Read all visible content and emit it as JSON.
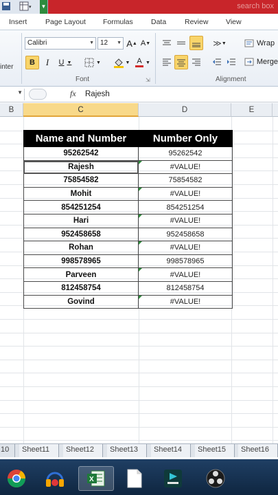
{
  "title_bar": {
    "search_placeholder": "search box"
  },
  "ribbon_tabs": [
    "Insert",
    "Page Layout",
    "Formulas",
    "Data",
    "Review",
    "View"
  ],
  "ribbon": {
    "clipboard_label": "inter",
    "font_name": "Calibri",
    "font_size": "12",
    "font_group_label": "Font",
    "bold_label": "B",
    "italic_label": "I",
    "underline_label": "U",
    "grow_font_label": "A",
    "shrink_font_label": "A",
    "font_color_label": "A",
    "wrap_label": "Wrap",
    "merge_label": "Merge",
    "alignment_group_label": "Alignment"
  },
  "formula_bar": {
    "fx_label": "fx",
    "content": "Rajesh"
  },
  "columns": [
    {
      "label": "B",
      "selected": false
    },
    {
      "label": "C",
      "selected": true
    },
    {
      "label": "D",
      "selected": false
    },
    {
      "label": "E",
      "selected": false
    }
  ],
  "table": {
    "header": [
      "Name and Number",
      "Number Only"
    ],
    "rows": [
      {
        "a": "95262542",
        "b": "95262542",
        "flag": false
      },
      {
        "a": "Rajesh",
        "b": "#VALUE!",
        "flag": true
      },
      {
        "a": "75854582",
        "b": "75854582",
        "flag": false
      },
      {
        "a": "Mohit",
        "b": "#VALUE!",
        "flag": true
      },
      {
        "a": "854251254",
        "b": "854251254",
        "flag": false
      },
      {
        "a": "Hari",
        "b": "#VALUE!",
        "flag": true
      },
      {
        "a": "952458658",
        "b": "952458658",
        "flag": false
      },
      {
        "a": "Rohan",
        "b": "#VALUE!",
        "flag": true
      },
      {
        "a": "998578965",
        "b": "998578965",
        "flag": false
      },
      {
        "a": "Parveen",
        "b": "#VALUE!",
        "flag": true
      },
      {
        "a": "812458754",
        "b": "812458754",
        "flag": false
      },
      {
        "a": "Govind",
        "b": "#VALUE!",
        "flag": true
      }
    ]
  },
  "sheet_tabs": [
    "10",
    "Sheet11",
    "Sheet12",
    "Sheet13",
    "Sheet14",
    "Sheet15",
    "Sheet16"
  ],
  "taskbar": {
    "items": [
      "chrome-icon",
      "media-icon",
      "excel-icon",
      "file-icon",
      "editor-icon",
      "obs-icon"
    ],
    "active": "excel-icon"
  },
  "colors": {
    "title_bar": "#c8252a",
    "header_fill": "#000000",
    "error_flag": "#2d8a3a",
    "selected_column": "#f8d98a",
    "taskbar": "#1a3557"
  }
}
